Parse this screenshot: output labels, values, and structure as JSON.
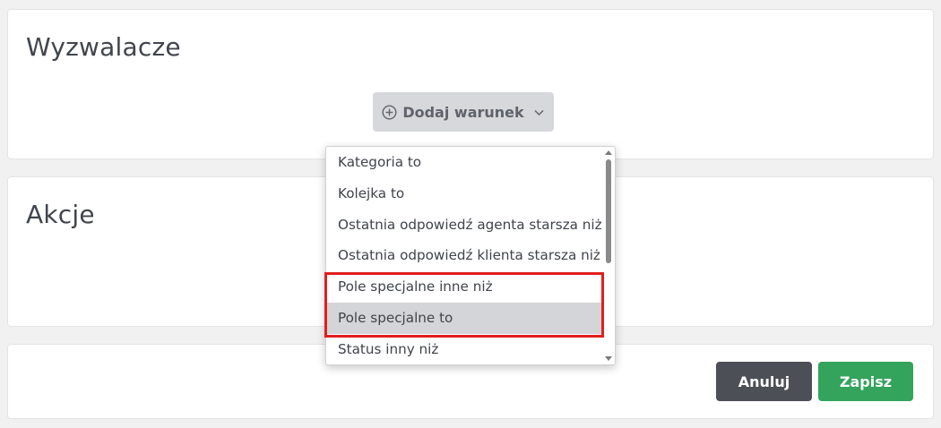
{
  "triggers": {
    "title": "Wyzwalacze",
    "add_condition_label": "Dodaj warunek",
    "add_icon": "plus-circle-icon",
    "chevron_icon": "chevron-down-icon"
  },
  "actions": {
    "title": "Akcje"
  },
  "dropdown": {
    "items": [
      {
        "label": "Kategoria to"
      },
      {
        "label": "Kolejka to"
      },
      {
        "label": "Ostatnia odpowiedź agenta starsza niż"
      },
      {
        "label": "Ostatnia odpowiedź klienta starsza niż"
      },
      {
        "label": "Pole specjalne inne niż"
      },
      {
        "label": "Pole specjalne to"
      },
      {
        "label": "Status inny niż"
      }
    ],
    "hovered_item": "Pole specjalne to",
    "highlighted_items": [
      "Pole specjalne inne niż",
      "Pole specjalne to"
    ],
    "highlight_color": "#e11f1f"
  },
  "footer": {
    "cancel_label": "Anuluj",
    "save_label": "Zapisz"
  },
  "colors": {
    "save_button": "#34a35c",
    "cancel_button": "#4d4f57",
    "add_button": "#d7d8dc"
  }
}
